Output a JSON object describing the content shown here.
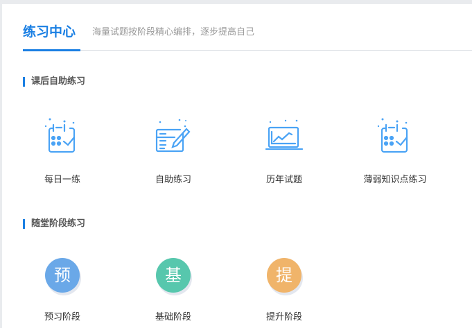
{
  "header": {
    "title": "练习中心",
    "subtitle": "海量试题按阶段精心编排，逐步提高自己"
  },
  "sections": [
    {
      "title": "课后自助练习",
      "items": [
        {
          "label": "每日一练",
          "icon": "calendar-check-icon"
        },
        {
          "label": "自助练习",
          "icon": "document-pen-icon"
        },
        {
          "label": "历年试题",
          "icon": "laptop-chart-icon"
        },
        {
          "label": "薄弱知识点练习",
          "icon": "calendar-check-icon"
        }
      ]
    },
    {
      "title": "随堂阶段练习",
      "items": [
        {
          "label": "预习阶段",
          "badge": "预",
          "color": "#6aa8e8"
        },
        {
          "label": "基础阶段",
          "badge": "基",
          "color": "#57c7ad"
        },
        {
          "label": "提升阶段",
          "badge": "提",
          "color": "#f0b46a"
        }
      ]
    }
  ],
  "colors": {
    "accent": "#1a7fe3",
    "icon": "#4aa3f5"
  }
}
